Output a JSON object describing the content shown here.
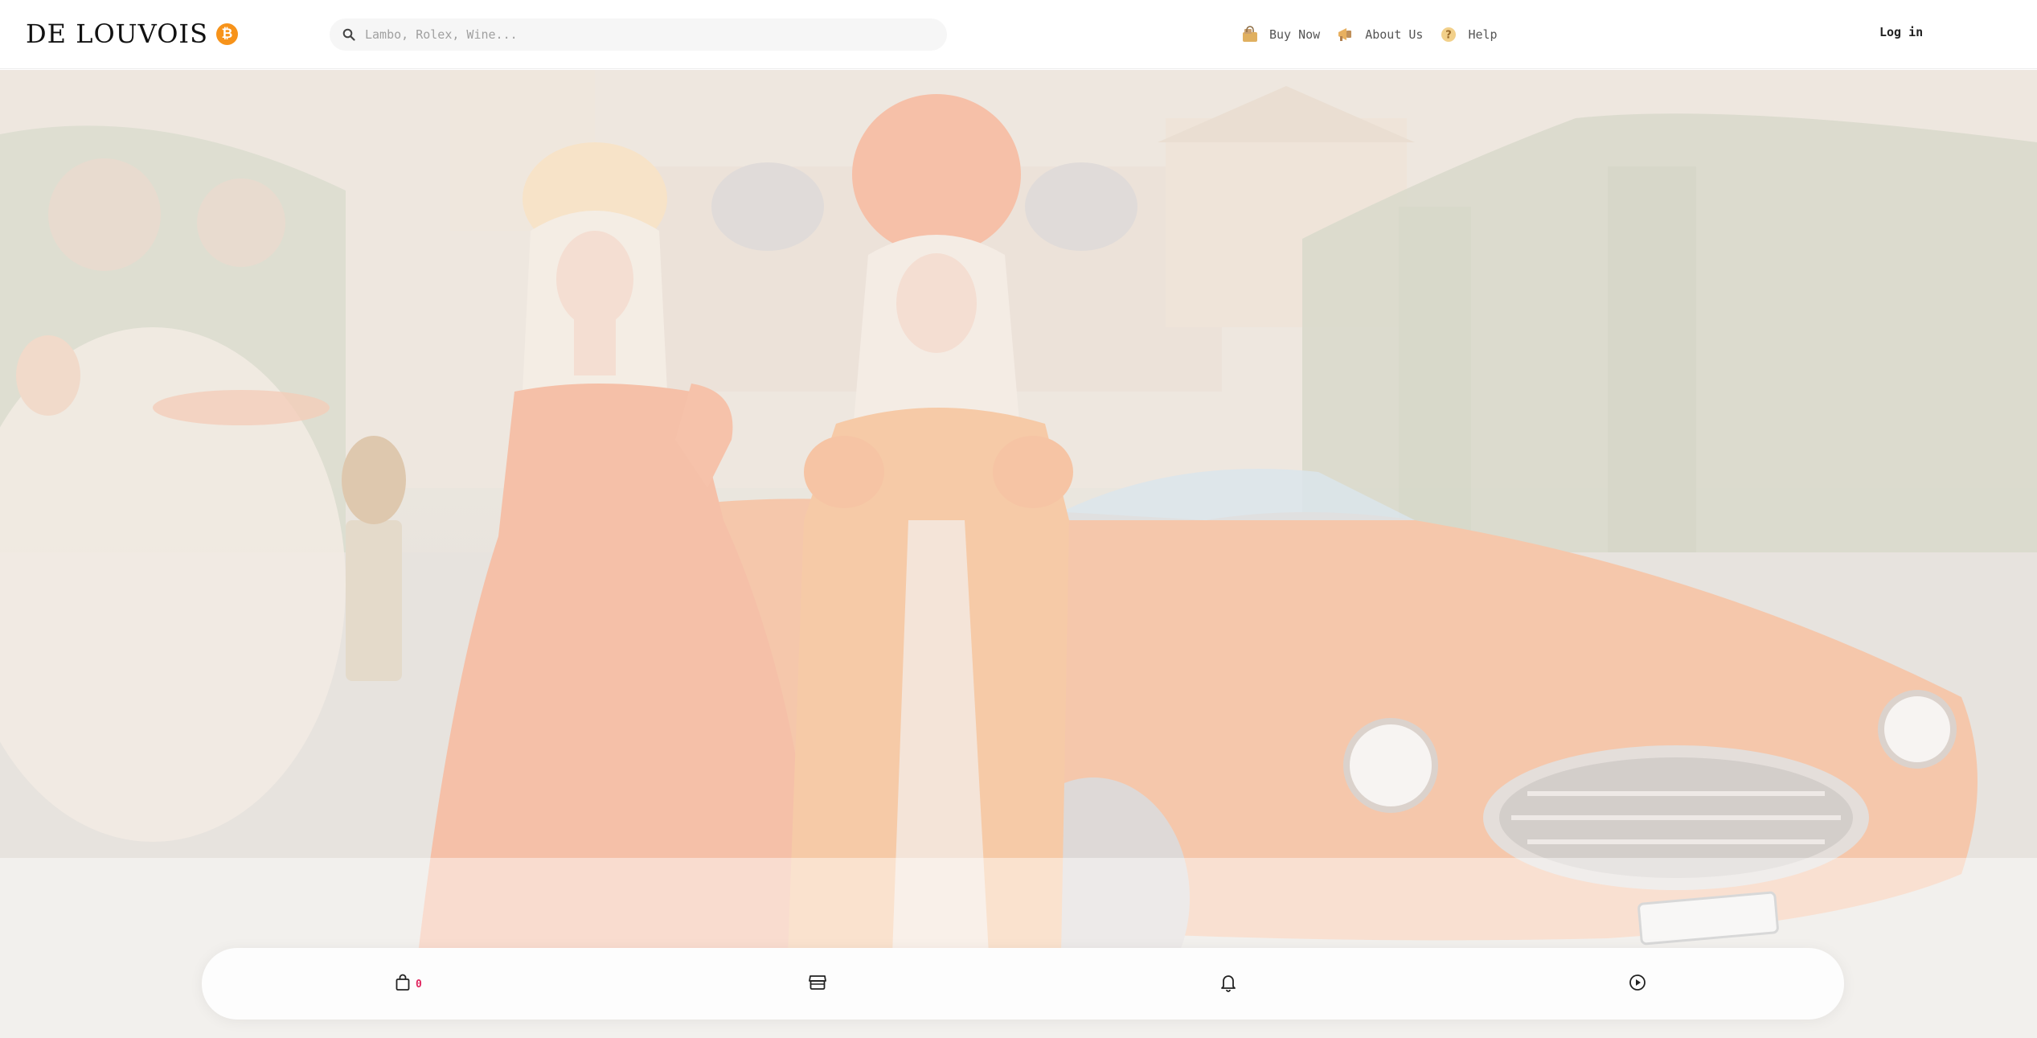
{
  "brand": {
    "name": "DE LOUVOIS",
    "badge_icon": "bitcoin-icon",
    "badge_symbol": "₿",
    "badge_color": "#f7931a"
  },
  "search": {
    "placeholder": "Lambo, Rolex, Wine...",
    "value": "",
    "icon": "search-icon"
  },
  "nav": {
    "items": [
      {
        "label": "Buy Now",
        "icon": "shopping-bag-icon"
      },
      {
        "label": "About Us",
        "icon": "megaphone-icon"
      },
      {
        "label": "Help",
        "icon": "help-circle-icon"
      }
    ]
  },
  "auth": {
    "login_label": "Log in"
  },
  "hero": {
    "image_icon": "hero-image",
    "accent": "#f0a070"
  },
  "bottom_bar": {
    "items": [
      {
        "icon": "shopping-bag-icon",
        "count": "0"
      },
      {
        "icon": "storefront-icon"
      },
      {
        "icon": "bell-icon"
      },
      {
        "icon": "play-circle-icon"
      }
    ],
    "count_color": "#e0245e"
  }
}
